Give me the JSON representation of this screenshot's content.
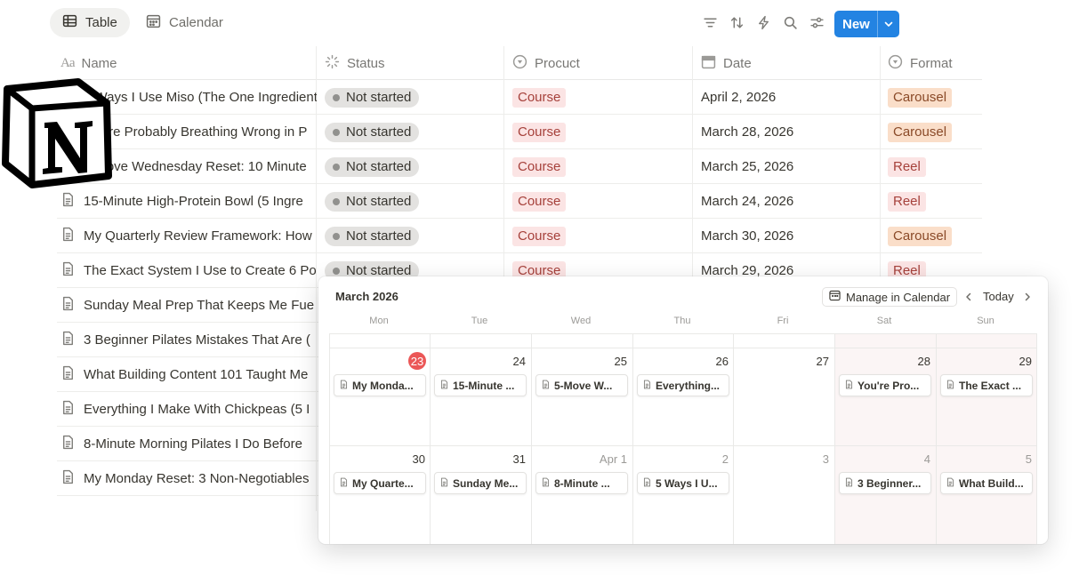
{
  "toolbar": {
    "views": [
      {
        "label": "Table",
        "icon": "table-icon",
        "active": true
      },
      {
        "label": "Calendar",
        "icon": "calendar-icon",
        "active": false
      }
    ],
    "tools": [
      "filter-icon",
      "sort-icon",
      "automation-icon",
      "search-icon",
      "settings-icon"
    ],
    "new_label": "New"
  },
  "table": {
    "columns": [
      {
        "label": "Name",
        "icon": "title-icon"
      },
      {
        "label": "Status",
        "icon": "status-icon"
      },
      {
        "label": "Procuct",
        "icon": "select-icon"
      },
      {
        "label": "Date",
        "icon": "date-icon"
      },
      {
        "label": "Format",
        "icon": "select-icon"
      }
    ],
    "rows": [
      {
        "name": "5 Ways I Use Miso (The One Ingredient",
        "status": "Not started",
        "product": "Course",
        "date": "April 2, 2026",
        "format": "Carousel"
      },
      {
        "name": "You're Probably Breathing Wrong in P",
        "status": "Not started",
        "product": "Course",
        "date": "March 28, 2026",
        "format": "Carousel"
      },
      {
        "name": "5-Move Wednesday Reset: 10 Minute",
        "status": "Not started",
        "product": "Course",
        "date": "March 25, 2026",
        "format": "Reel"
      },
      {
        "name": "15-Minute High-Protein Bowl (5 Ingre",
        "status": "Not started",
        "product": "Course",
        "date": "March 24, 2026",
        "format": "Reel"
      },
      {
        "name": "My Quarterly Review Framework: How",
        "status": "Not started",
        "product": "Course",
        "date": "March 30, 2026",
        "format": "Carousel"
      },
      {
        "name": "The Exact System I Use to Create 6 Po",
        "status": "Not started",
        "product": "Course",
        "date": "March 29, 2026",
        "format": "Reel"
      },
      {
        "name": "Sunday Meal Prep That Keeps Me Fue",
        "status": "",
        "product": "",
        "date": "",
        "format": ""
      },
      {
        "name": "3 Beginner Pilates Mistakes That Are (",
        "status": "",
        "product": "",
        "date": "",
        "format": ""
      },
      {
        "name": "What Building Content 101 Taught Me",
        "status": "",
        "product": "",
        "date": "",
        "format": ""
      },
      {
        "name": "Everything I Make With Chickpeas (5 I",
        "status": "",
        "product": "",
        "date": "",
        "format": ""
      },
      {
        "name": "8-Minute Morning Pilates I Do Before",
        "status": "",
        "product": "",
        "date": "",
        "format": ""
      },
      {
        "name": "My Monday Reset: 3 Non-Negotiables",
        "status": "",
        "product": "",
        "date": "",
        "format": ""
      }
    ]
  },
  "calendar": {
    "month_label": "March 2026",
    "manage_label": "Manage in Calendar",
    "today_label": "Today",
    "weekdays": [
      "Mon",
      "Tue",
      "Wed",
      "Thu",
      "Fri",
      "Sat",
      "Sun"
    ],
    "weeks": [
      [
        {
          "day": "23",
          "today": true,
          "muted": false,
          "event": "My Monda..."
        },
        {
          "day": "24",
          "today": false,
          "muted": false,
          "event": "15-Minute ..."
        },
        {
          "day": "25",
          "today": false,
          "muted": false,
          "event": "5-Move W..."
        },
        {
          "day": "26",
          "today": false,
          "muted": false,
          "event": "Everything..."
        },
        {
          "day": "27",
          "today": false,
          "muted": false,
          "event": ""
        },
        {
          "day": "28",
          "today": false,
          "muted": false,
          "event": "You're Pro..."
        },
        {
          "day": "29",
          "today": false,
          "muted": false,
          "event": "The Exact ..."
        }
      ],
      [
        {
          "day": "30",
          "today": false,
          "muted": false,
          "event": "My Quarte..."
        },
        {
          "day": "31",
          "today": false,
          "muted": false,
          "event": "Sunday Me..."
        },
        {
          "day": "Apr 1",
          "today": false,
          "muted": true,
          "event": "8-Minute ..."
        },
        {
          "day": "2",
          "today": false,
          "muted": true,
          "event": "5 Ways I U..."
        },
        {
          "day": "3",
          "today": false,
          "muted": true,
          "event": ""
        },
        {
          "day": "4",
          "today": false,
          "muted": true,
          "event": "3 Beginner..."
        },
        {
          "day": "5",
          "today": false,
          "muted": true,
          "event": "What Build..."
        }
      ]
    ]
  },
  "colors": {
    "accent": "#2383e2",
    "today_marker": "#eb5757",
    "course_tag_bg": "#fbe4e4",
    "carousel_tag_bg": "#fadec9",
    "status_bg": "#e3e2e0"
  }
}
